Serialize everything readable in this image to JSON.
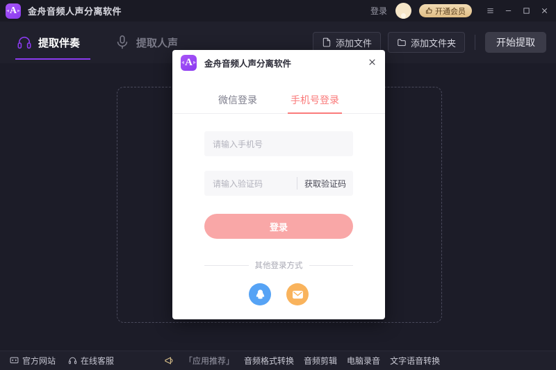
{
  "titlebar": {
    "logo_letter": "A",
    "app_title": "金舟音频人声分离软件",
    "login_text": "登录",
    "vip_label": "开通会员",
    "vip_icon": "thumbs-up-icon",
    "menu_icon": "hamburger-menu-icon",
    "minimize_icon": "minimize-icon",
    "maximize_icon": "maximize-icon",
    "close_icon": "close-icon",
    "accent_purple": "#8b3bf0",
    "vip_gold": "#e0bd85"
  },
  "toolbar": {
    "tabs": [
      {
        "label": "提取伴奏",
        "icon": "headphones-icon",
        "active": true
      },
      {
        "label": "提取人声",
        "icon": "microphone-icon",
        "active": false
      }
    ],
    "add_file_label": "添加文件",
    "add_file_icon": "file-icon",
    "add_folder_label": "添加文件夹",
    "add_folder_icon": "folder-icon",
    "start_label": "开始提取",
    "start_disabled": true
  },
  "dropzone": {
    "border_style": "dashed",
    "border_color": "#4a4a5c"
  },
  "bottombar": {
    "official_site": {
      "label": "官方网站",
      "icon": "monitor-icon"
    },
    "online_service": {
      "label": "在线客服",
      "icon": "headset-icon"
    },
    "recommend_icon": "megaphone-icon",
    "recommend_label": "「应用推荐」",
    "links": [
      "音频格式转换",
      "音频剪辑",
      "电脑录音",
      "文字语音转换"
    ]
  },
  "modal": {
    "logo_letter": "A",
    "title": "金舟音频人声分离软件",
    "close_icon": "close-icon",
    "tabs": [
      {
        "label": "微信登录",
        "active": false
      },
      {
        "label": "手机号登录",
        "active": true
      }
    ],
    "phone_placeholder": "请输入手机号",
    "phone_value": "",
    "code_placeholder": "请输入验证码",
    "code_value": "",
    "get_code_label": "获取验证码",
    "submit_label": "登录",
    "other_login_label": "其他登录方式",
    "socials": [
      {
        "name": "qq-login-icon",
        "color": "#56a3f5"
      },
      {
        "name": "email-login-icon",
        "color": "#f9b35c"
      }
    ],
    "accent_pink": "#fa7a7a",
    "submit_bg": "#f9a7a7"
  }
}
